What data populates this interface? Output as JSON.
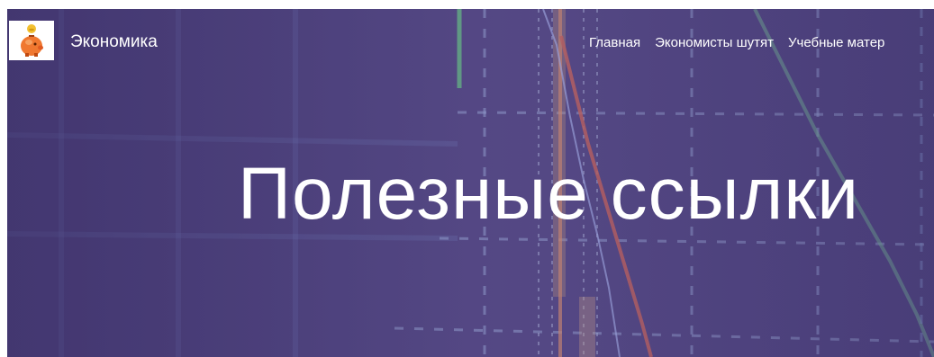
{
  "header": {
    "brand": "Экономика",
    "logo_icon": "piggy-bank-coin-icon",
    "nav": [
      {
        "label": "Главная"
      },
      {
        "label": "Экономисты шутят"
      },
      {
        "label": "Учебные матер"
      }
    ]
  },
  "hero": {
    "title": "Полезные ссылки",
    "background": "financial-chart-display"
  },
  "colors": {
    "hero_base": "#554a85",
    "text": "#ffffff",
    "chart_green": "#6ed68a",
    "chart_red": "#e0705a",
    "grid": "#8fa6d6"
  }
}
